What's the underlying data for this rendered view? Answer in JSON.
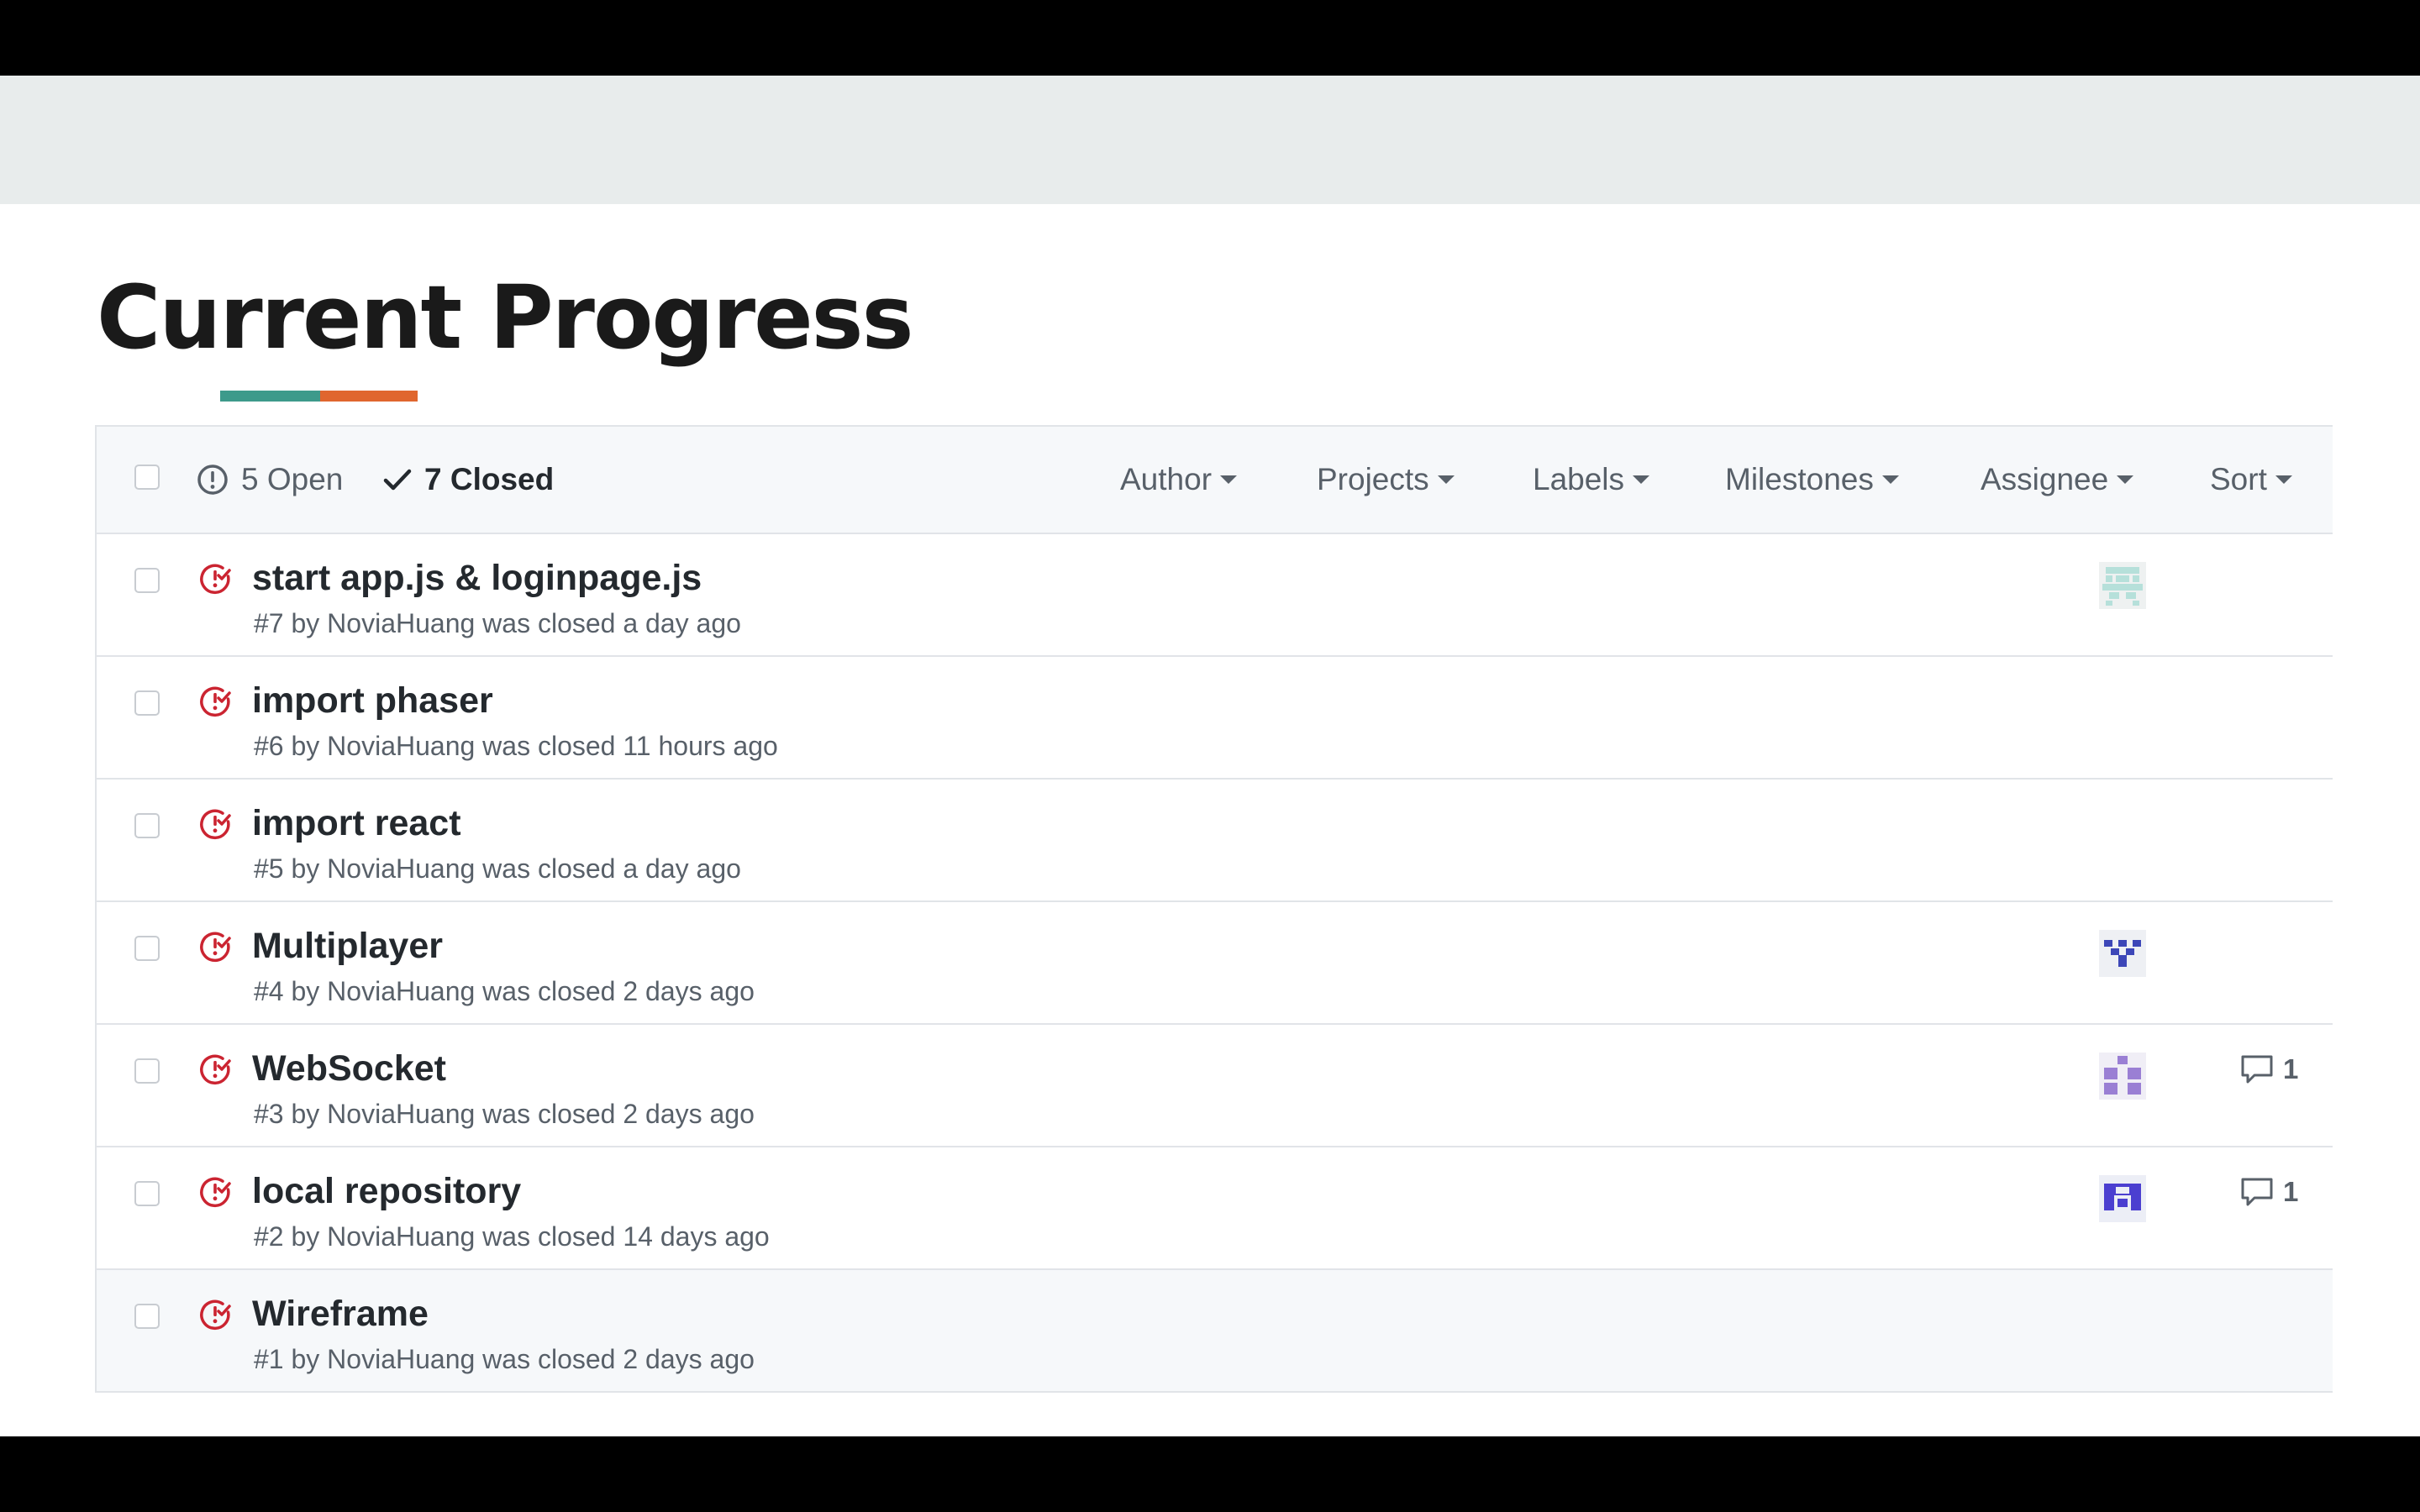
{
  "slide": {
    "title": "Current Progress"
  },
  "colors": {
    "accent_teal": "#3d9a8b",
    "accent_orange": "#e0662e",
    "closed_red": "#cb2431"
  },
  "issues_panel": {
    "header": {
      "open_label": "5 Open",
      "closed_label": "7 Closed",
      "filters": [
        "Author",
        "Projects",
        "Labels",
        "Milestones",
        "Assignee",
        "Sort"
      ]
    },
    "issues": [
      {
        "title": "start app.js & loginpage.js",
        "meta": "#7 by NoviaHuang was closed a day ago",
        "assignee_avatar": "avatar-light-teal-identicon",
        "comments": ""
      },
      {
        "title": "import phaser",
        "meta": "#6 by NoviaHuang was closed 11 hours ago",
        "assignee_avatar": "",
        "comments": ""
      },
      {
        "title": "import react",
        "meta": "#5 by NoviaHuang was closed a day ago",
        "assignee_avatar": "",
        "comments": ""
      },
      {
        "title": "Multiplayer",
        "meta": "#4 by NoviaHuang was closed 2 days ago",
        "assignee_avatar": "avatar-blue-identicon",
        "comments": ""
      },
      {
        "title": "WebSocket",
        "meta": "#3 by NoviaHuang was closed 2 days ago",
        "assignee_avatar": "avatar-lavender-identicon",
        "comments": "1"
      },
      {
        "title": "local repository",
        "meta": "#2 by NoviaHuang was closed 14 days ago",
        "assignee_avatar": "avatar-indigo-identicon",
        "comments": "1"
      },
      {
        "title": "Wireframe",
        "meta": "#1 by NoviaHuang was closed 2 days ago",
        "assignee_avatar": "",
        "comments": ""
      }
    ]
  }
}
